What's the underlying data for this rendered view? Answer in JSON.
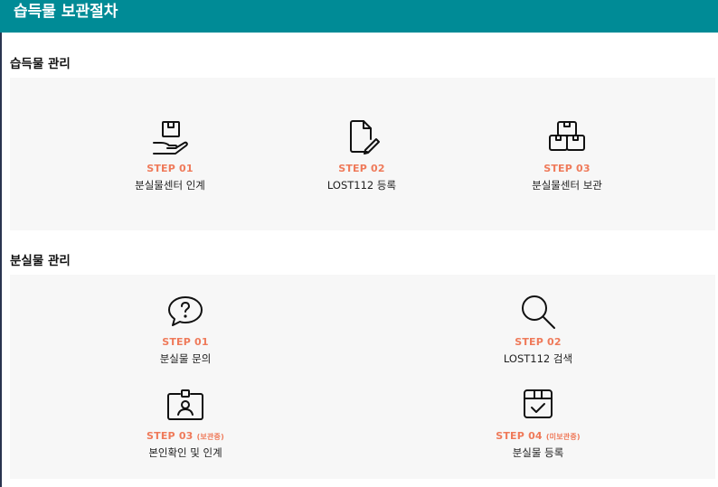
{
  "header": {
    "title": "습득물 보관절차"
  },
  "acquired": {
    "title": "습득물 관리",
    "steps": [
      {
        "num": "STEP 01",
        "label": "분실물센터 인계",
        "icon": "hand-box-icon"
      },
      {
        "num": "STEP 02",
        "label": "LOST112 등록",
        "icon": "document-edit-icon"
      },
      {
        "num": "STEP 03",
        "label": "분실물센터 보관",
        "icon": "boxes-icon"
      }
    ]
  },
  "lost": {
    "title": "분실물 관리",
    "steps": [
      {
        "num": "STEP 01",
        "sub": "",
        "label": "분실물 문의",
        "icon": "question-bubble-icon"
      },
      {
        "num": "STEP 02",
        "sub": "",
        "label": "LOST112 검색",
        "icon": "search-icon"
      },
      {
        "num": "STEP 03",
        "sub": "(보관중)",
        "label": "본인확인 및 인계",
        "icon": "id-badge-icon"
      },
      {
        "num": "STEP 04",
        "sub": "(미보관중)",
        "label": "분실물 등록",
        "icon": "box-check-icon"
      }
    ]
  }
}
